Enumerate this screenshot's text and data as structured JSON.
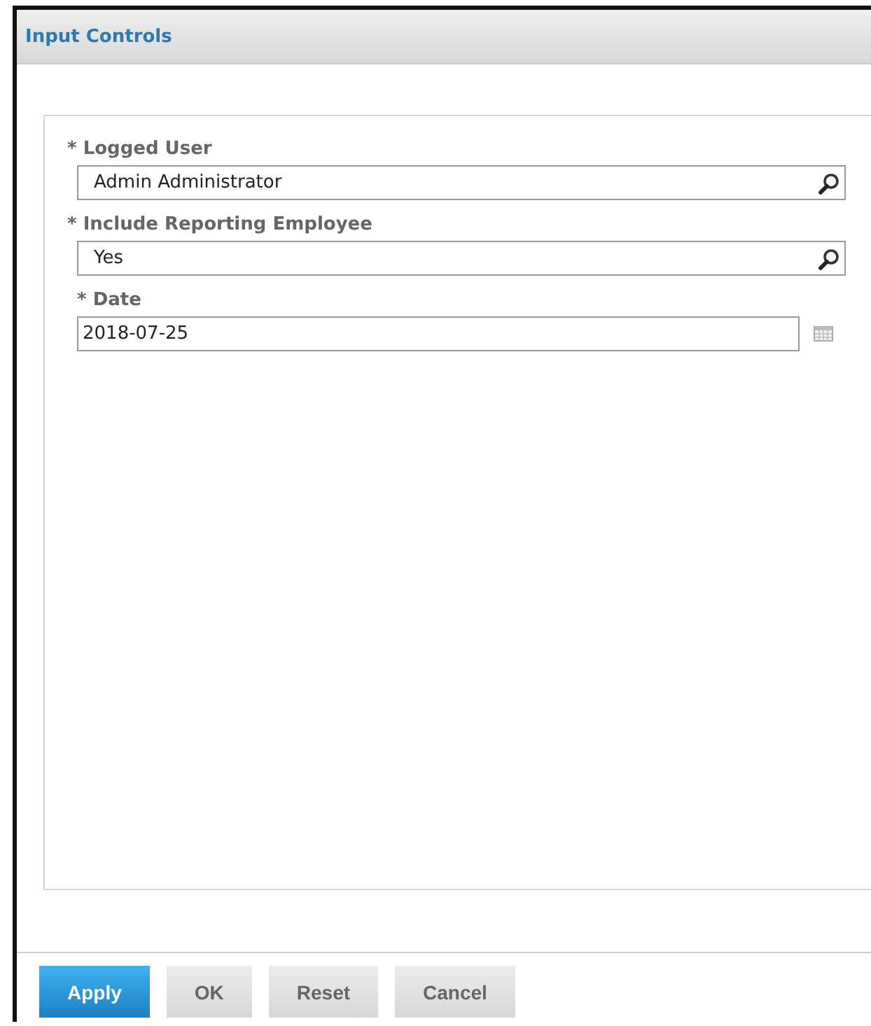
{
  "window": {
    "title": "Input Controls"
  },
  "fields": [
    {
      "kind": "lookup",
      "label": "* Logged User",
      "value": "Admin Administrator"
    },
    {
      "kind": "lookup",
      "label": "* Include Reporting Employee",
      "value": "Yes"
    },
    {
      "kind": "date",
      "label": "* Date",
      "value": "2018-07-25"
    }
  ],
  "buttons": [
    {
      "label": "Apply",
      "kind": "primary"
    },
    {
      "label": "OK",
      "kind": "secondary"
    },
    {
      "label": "Reset",
      "kind": "secondary"
    },
    {
      "label": "Cancel",
      "kind": "secondary"
    }
  ]
}
